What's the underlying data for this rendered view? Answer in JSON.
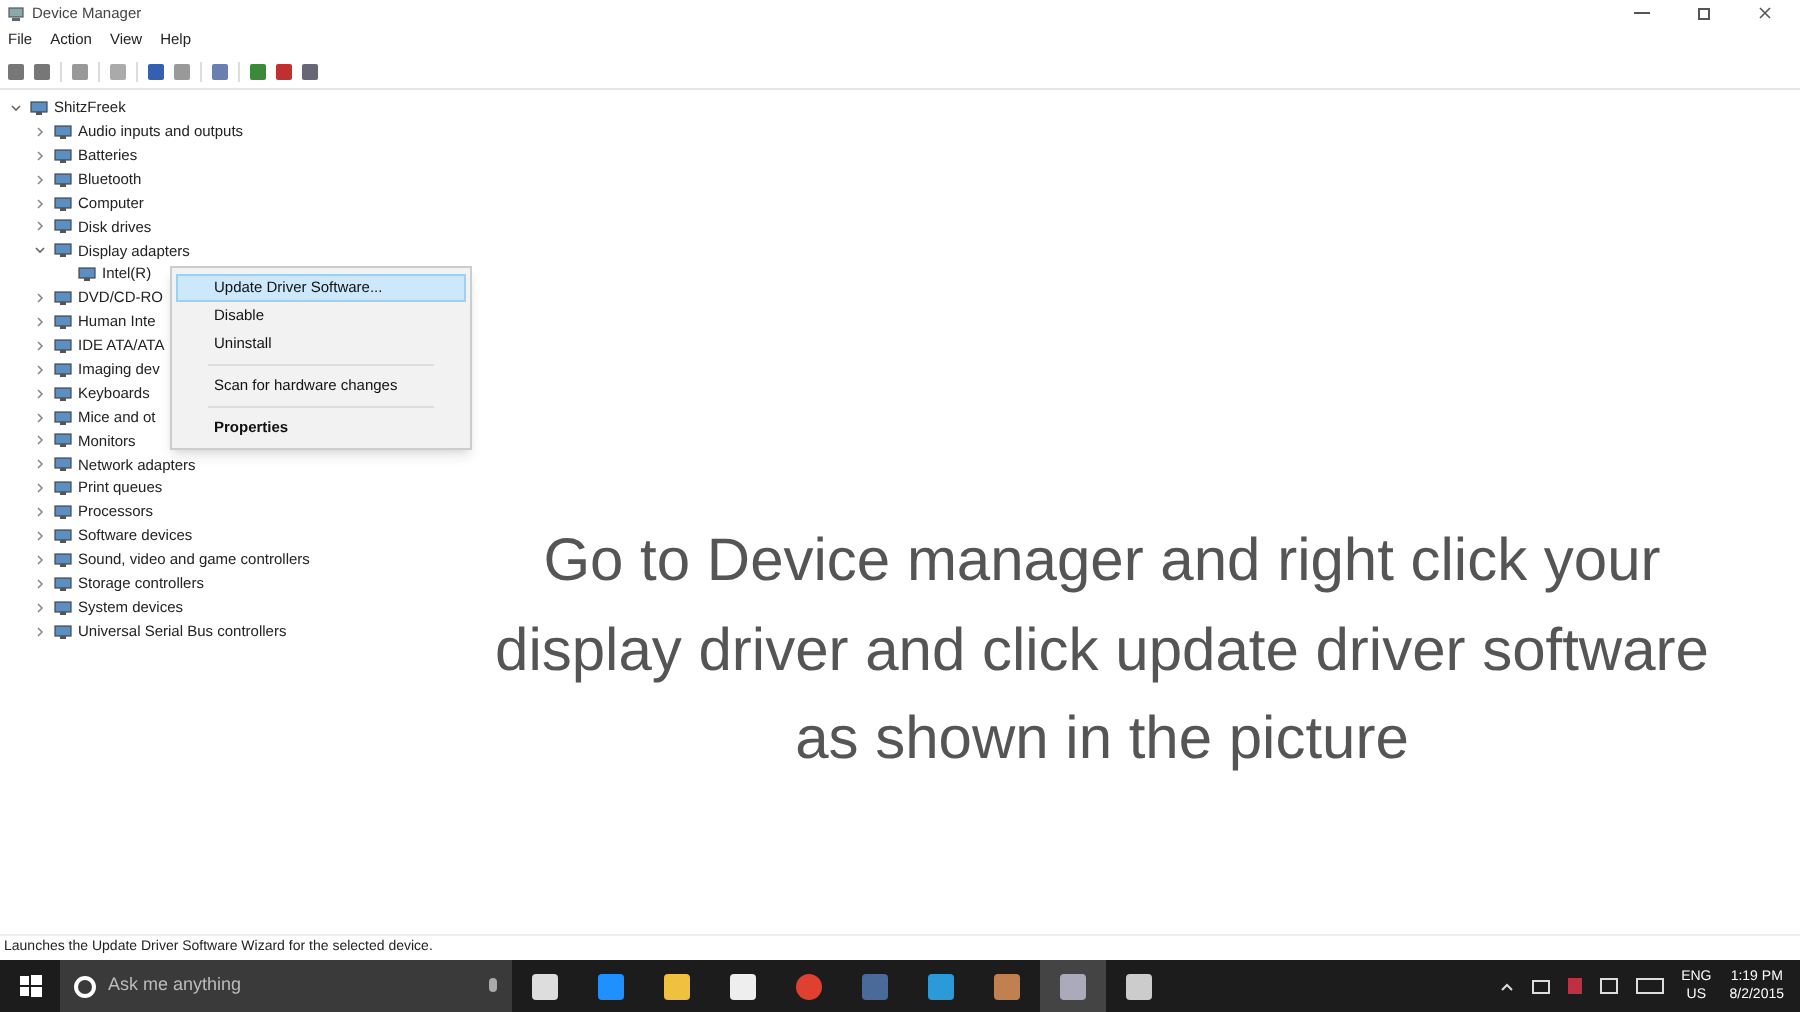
{
  "window": {
    "title": "Device Manager"
  },
  "menu": [
    "File",
    "Action",
    "View",
    "Help"
  ],
  "tree": {
    "label": "ShitzFreek",
    "expanded": true,
    "children": [
      {
        "label": "Audio inputs and outputs",
        "expanded": false
      },
      {
        "label": "Batteries",
        "expanded": false
      },
      {
        "label": "Bluetooth",
        "expanded": false
      },
      {
        "label": "Computer",
        "expanded": false
      },
      {
        "label": "Disk drives",
        "expanded": false
      },
      {
        "label": "Display adapters",
        "expanded": true,
        "children": [
          {
            "label": "Intel(R)"
          }
        ]
      },
      {
        "label": "DVD/CD-RO",
        "expanded": false
      },
      {
        "label": "Human Inte",
        "expanded": false
      },
      {
        "label": "IDE ATA/ATA",
        "expanded": false
      },
      {
        "label": "Imaging dev",
        "expanded": false
      },
      {
        "label": "Keyboards",
        "expanded": false
      },
      {
        "label": "Mice and ot",
        "expanded": false
      },
      {
        "label": "Monitors",
        "expanded": false
      },
      {
        "label": "Network adapters",
        "expanded": false
      },
      {
        "label": "Print queues",
        "expanded": false
      },
      {
        "label": "Processors",
        "expanded": false
      },
      {
        "label": "Software devices",
        "expanded": false
      },
      {
        "label": "Sound, video and game controllers",
        "expanded": false
      },
      {
        "label": "Storage controllers",
        "expanded": false
      },
      {
        "label": "System devices",
        "expanded": false
      },
      {
        "label": "Universal Serial Bus controllers",
        "expanded": false
      }
    ]
  },
  "context_menu": [
    {
      "kind": "item",
      "label": "Update Driver Software...",
      "selected": true
    },
    {
      "kind": "item",
      "label": "Disable",
      "selected": false
    },
    {
      "kind": "item",
      "label": "Uninstall",
      "selected": false
    },
    {
      "kind": "separator"
    },
    {
      "kind": "item",
      "label": "Scan for hardware changes",
      "selected": false
    },
    {
      "kind": "separator"
    },
    {
      "kind": "default",
      "label": "Properties",
      "selected": false
    }
  ],
  "caption": "Go to Device manager and right click your display driver and click update driver software as shown in the picture",
  "status_bar": "Launches the Update Driver Software Wizard for the selected device.",
  "taskbar": {
    "search_placeholder": "Ask me anything",
    "language": "ENG",
    "region": "US",
    "time": "1:19 PM",
    "date": "8/2/2015"
  }
}
